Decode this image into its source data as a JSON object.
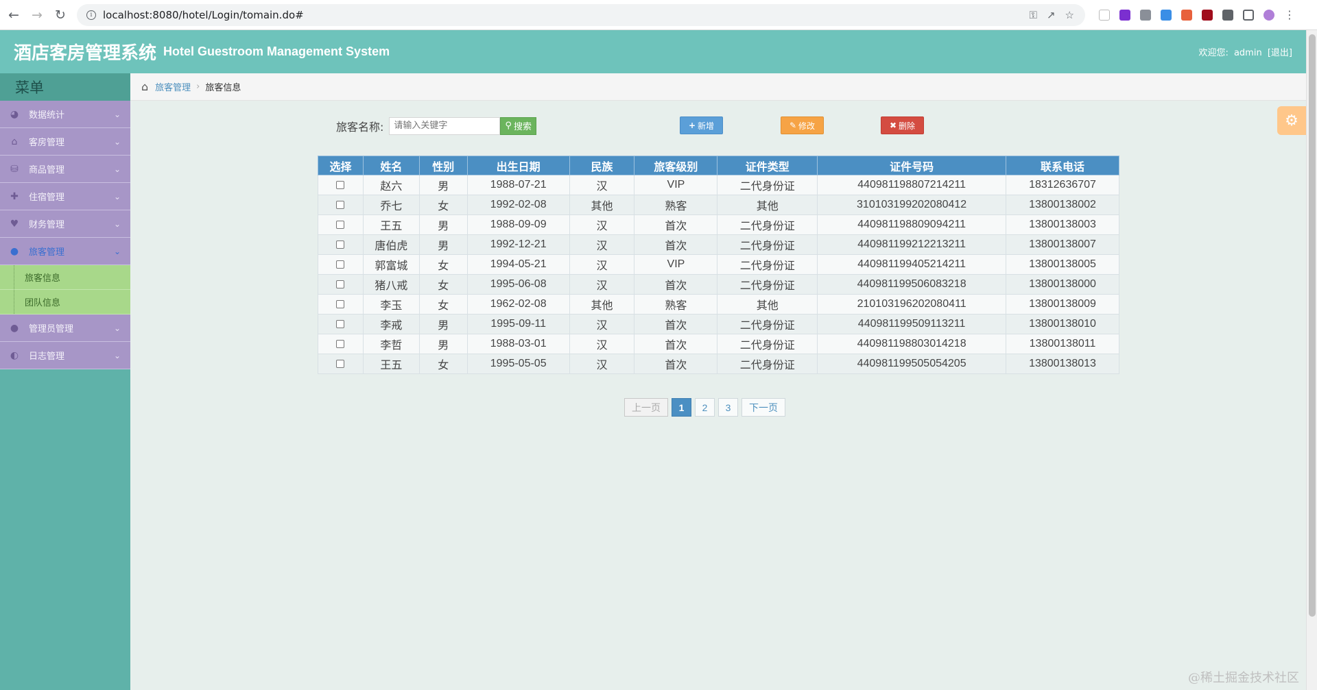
{
  "browser": {
    "url": "localhost:8080/hotel/Login/tomain.do#"
  },
  "header": {
    "title_cn": "酒店客房管理系统",
    "title_en": "Hotel Guestroom Management System",
    "welcome_label": "欢迎您:",
    "username": "admin",
    "logout": "[退出]"
  },
  "sidebar": {
    "title": "菜单",
    "items": [
      {
        "label": "数据统计",
        "icon": "dashboard-icon"
      },
      {
        "label": "客房管理",
        "icon": "home-icon"
      },
      {
        "label": "商品管理",
        "icon": "database-icon"
      },
      {
        "label": "住宿管理",
        "icon": "move-icon"
      },
      {
        "label": "财务管理",
        "icon": "heart-icon"
      },
      {
        "label": "旅客管理",
        "icon": "user-icon"
      },
      {
        "label": "管理员管理",
        "icon": "user-icon"
      },
      {
        "label": "日志管理",
        "icon": "adjust-icon"
      }
    ],
    "subitems": [
      {
        "label": "旅客信息"
      },
      {
        "label": "团队信息"
      }
    ]
  },
  "breadcrumb": {
    "parent": "旅客管理",
    "current": "旅客信息"
  },
  "search": {
    "label": "旅客名称:",
    "placeholder": "请输入关键字",
    "button": "搜索"
  },
  "actions": {
    "add": "新增",
    "edit": "修改",
    "delete": "删除"
  },
  "table": {
    "headers": [
      "选择",
      "姓名",
      "性别",
      "出生日期",
      "民族",
      "旅客级别",
      "证件类型",
      "证件号码",
      "联系电话"
    ],
    "rows": [
      [
        "赵六",
        "男",
        "1988-07-21",
        "汉",
        "VIP",
        "二代身份证",
        "440981198807214211",
        "18312636707"
      ],
      [
        "乔七",
        "女",
        "1992-02-08",
        "其他",
        "熟客",
        "其他",
        "310103199202080412",
        "13800138002"
      ],
      [
        "王五",
        "男",
        "1988-09-09",
        "汉",
        "首次",
        "二代身份证",
        "440981198809094211",
        "13800138003"
      ],
      [
        "唐伯虎",
        "男",
        "1992-12-21",
        "汉",
        "首次",
        "二代身份证",
        "440981199212213211",
        "13800138007"
      ],
      [
        "郭富城",
        "女",
        "1994-05-21",
        "汉",
        "VIP",
        "二代身份证",
        "440981199405214211",
        "13800138005"
      ],
      [
        "猪八戒",
        "女",
        "1995-06-08",
        "汉",
        "首次",
        "二代身份证",
        "440981199506083218",
        "13800138000"
      ],
      [
        "李玉",
        "女",
        "1962-02-08",
        "其他",
        "熟客",
        "其他",
        "210103196202080411",
        "13800138009"
      ],
      [
        "李戒",
        "男",
        "1995-09-11",
        "汉",
        "首次",
        "二代身份证",
        "440981199509113211",
        "13800138010"
      ],
      [
        "李哲",
        "男",
        "1988-03-01",
        "汉",
        "首次",
        "二代身份证",
        "440981198803014218",
        "13800138011"
      ],
      [
        "王五",
        "女",
        "1995-05-05",
        "汉",
        "首次",
        "二代身份证",
        "440981199505054205",
        "13800138013"
      ]
    ]
  },
  "pagination": {
    "prev": "上一页",
    "pages": [
      "1",
      "2",
      "3"
    ],
    "current": "1",
    "next": "下一页"
  },
  "watermark": "@稀土掘金技术社区",
  "colors": {
    "header_bg": "#6ec3bb",
    "sidebar_bg": "#5fb2a9",
    "menu_item_bg": "#a796c7",
    "submenu_bg": "#a8d88a",
    "table_header_bg": "#4b8fc3"
  }
}
